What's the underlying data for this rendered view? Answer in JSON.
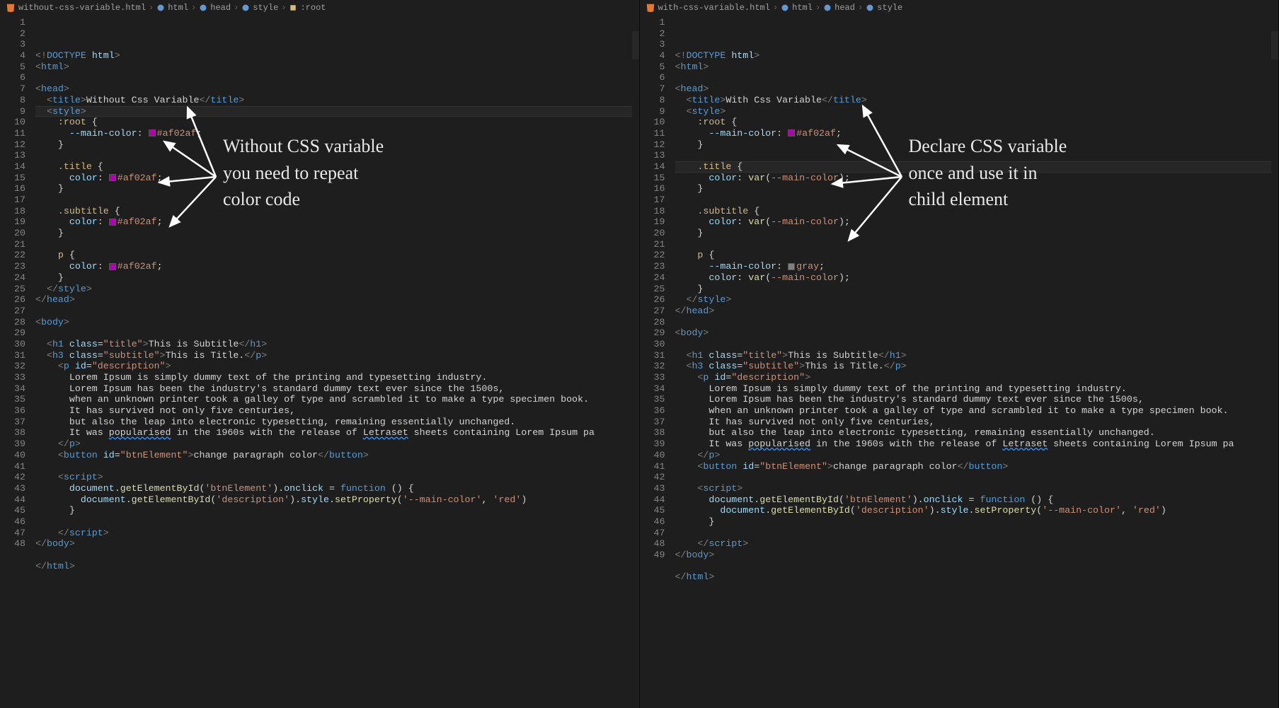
{
  "left": {
    "breadcrumb": {
      "file": "without-css-variable.html",
      "p1": "html",
      "p2": "head",
      "p3": "style",
      "p4": ":root"
    },
    "lines": 48,
    "annotation": {
      "l1": "Without CSS variable",
      "l2": "you need to repeat",
      "l3": "color code"
    },
    "code": {
      "title_text": "Without Css Variable",
      "root_prop": "--main-color",
      "root_val": "#af02af",
      "title_color": "#af02af",
      "subtitle_color": "#af02af",
      "p_color": "#af02af",
      "h1_text": "This is Subtitle",
      "h3_text": "This is Title.",
      "p_l1": "Lorem Ipsum is simply dummy text of the printing and typesetting industry.",
      "p_l2": "Lorem Ipsum has been the industry's standard dummy text ever since the 1500s,",
      "p_l3": "when an unknown printer took a galley of type and scrambled it to make a type specimen book.",
      "p_l4": "It has survived not only five centuries,",
      "p_l5": "but also the leap into electronic typesetting, remaining essentially unchanged.",
      "p_l6a": "It was ",
      "p_l6b": "popularised",
      "p_l6c": " in the 1960s with the release of ",
      "p_l6d": "Letraset",
      "p_l6e": " sheets containing Lorem Ipsum pa",
      "btn_text": "change paragraph color",
      "js_btn": "btnElement",
      "js_desc": "description",
      "js_prop": "--main-color",
      "js_val": "red"
    }
  },
  "right": {
    "breadcrumb": {
      "file": "with-css-variable.html",
      "p1": "html",
      "p2": "head",
      "p3": "style"
    },
    "lines": 49,
    "annotation": {
      "l1": "Declare CSS variable",
      "l2": "once and use it in",
      "l3": "child element"
    },
    "code": {
      "title_text": "With Css Variable",
      "root_prop": "--main-color",
      "root_val": "#af02af",
      "var_call": "var(--main-color)",
      "p_override_prop": "--main-color",
      "p_override_val": "gray",
      "h1_text": "This is Subtitle",
      "h3_text": "This is Title.",
      "p_l1": "Lorem Ipsum is simply dummy text of the printing and typesetting industry.",
      "p_l2": "Lorem Ipsum has been the industry's standard dummy text ever since the 1500s,",
      "p_l3": "when an unknown printer took a galley of type and scrambled it to make a type specimen book.",
      "p_l4": "It has survived not only five centuries,",
      "p_l5": "but also the leap into electronic typesetting, remaining essentially unchanged.",
      "p_l6a": "It was ",
      "p_l6b": "popularised",
      "p_l6c": " in the 1960s with the release of ",
      "p_l6d": "Letraset",
      "p_l6e": " sheets containing Lorem Ipsum pa",
      "btn_text": "change paragraph color",
      "js_btn": "btnElement",
      "js_desc": "description",
      "js_prop": "--main-color",
      "js_val": "red"
    }
  },
  "colors": {
    "magenta": "#af02af",
    "gray": "#808080"
  }
}
